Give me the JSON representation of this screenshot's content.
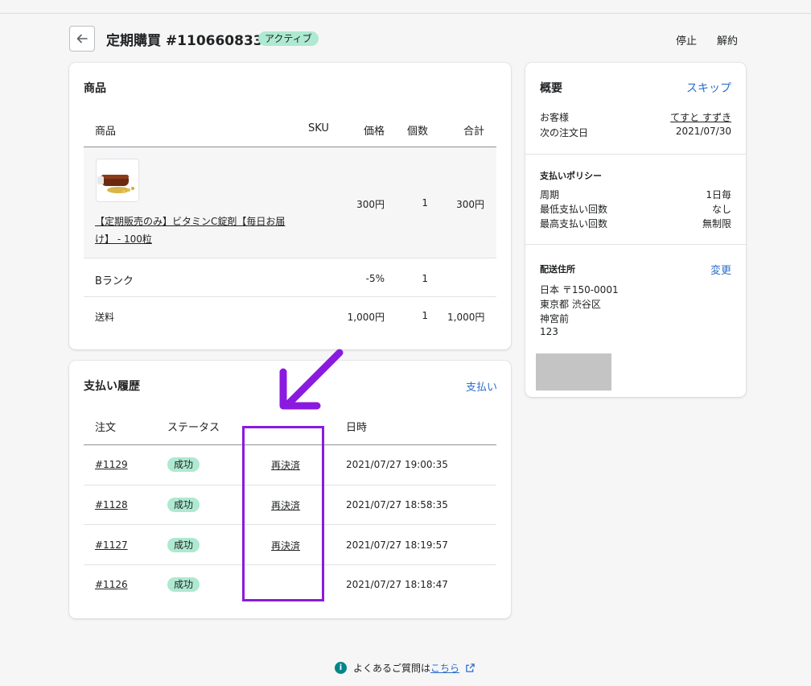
{
  "header": {
    "title": "定期購買 #1106608333",
    "status": "アクティブ",
    "pause_label": "停止",
    "cancel_label": "解約"
  },
  "products": {
    "title": "商品",
    "columns": {
      "product": "商品",
      "sku": "SKU",
      "price": "価格",
      "qty": "個数",
      "total": "合計"
    },
    "item": {
      "name_line1": "【定期販売のみ】ビタミンC錠剤【毎日お届",
      "name_line2": "け】 - 100粒",
      "price": "300円",
      "qty": "1",
      "total": "300円"
    },
    "rank": {
      "label": "Bランク",
      "discount": "-5%",
      "qty": "1"
    },
    "shipping": {
      "label": "送料",
      "price": "1,000円",
      "qty": "1",
      "total": "1,000円"
    }
  },
  "history": {
    "title": "支払い履歴",
    "action": "支払い",
    "columns": {
      "order": "注文",
      "status": "ステータス",
      "date": "日時"
    },
    "rows": [
      {
        "order": "#1129",
        "status": "成功",
        "repay": "再決済",
        "date": "2021/07/27 19:00:35"
      },
      {
        "order": "#1128",
        "status": "成功",
        "repay": "再決済",
        "date": "2021/07/27 18:58:35"
      },
      {
        "order": "#1127",
        "status": "成功",
        "repay": "再決済",
        "date": "2021/07/27 18:19:57"
      },
      {
        "order": "#1126",
        "status": "成功",
        "repay": "",
        "date": "2021/07/27 18:18:47"
      }
    ]
  },
  "summary": {
    "title": "概要",
    "skip": "スキップ",
    "customer_label": "お客様",
    "customer_name": "てすと すずき",
    "next_order_label": "次の注文日",
    "next_order_date": "2021/07/30",
    "policy_title": "支払いポリシー",
    "cycle_label": "周期",
    "cycle_value": "1日毎",
    "min_label": "最低支払い回数",
    "min_value": "なし",
    "max_label": "最高支払い回数",
    "max_value": "無制限",
    "address_title": "配送住所",
    "change": "変更",
    "address": [
      "日本 〒150-0001",
      "東京都 渋谷区",
      "神宮前",
      "123"
    ]
  },
  "footer": {
    "text": "よくあるご質問は",
    "link": "こちら"
  },
  "colors": {
    "accent": "#2c6ecb",
    "success_badge": "#aee9d1",
    "annotation": "#8a1ae0"
  }
}
